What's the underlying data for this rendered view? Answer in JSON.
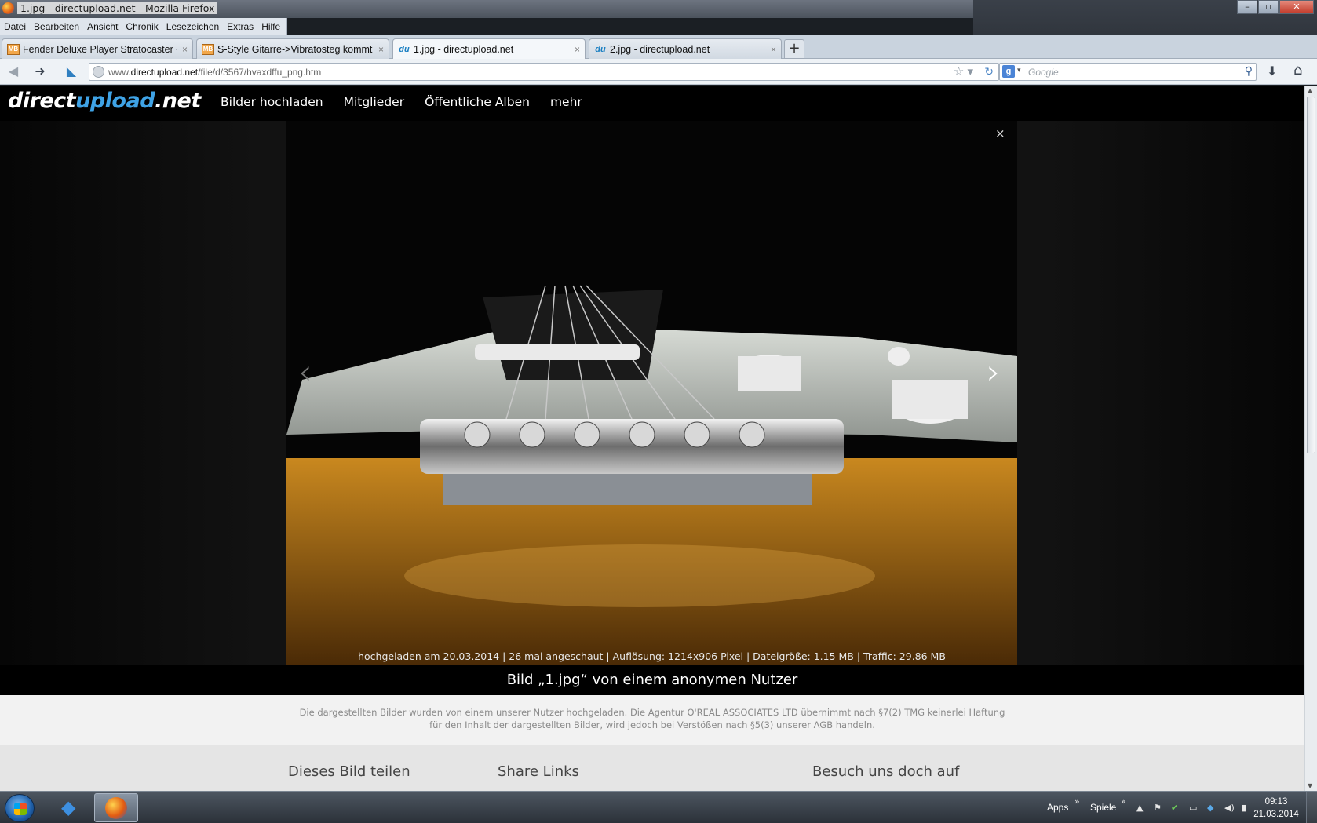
{
  "window": {
    "title": "1.jpg - directupload.net - Mozilla Firefox",
    "controls": {
      "minimize": "–",
      "maximize": "▫",
      "close": "✕"
    }
  },
  "menubar": [
    "Datei",
    "Bearbeiten",
    "Ansicht",
    "Chronik",
    "Lesezeichen",
    "Extras",
    "Hilfe"
  ],
  "tabs": [
    {
      "favicon": "MB",
      "label": "Fender Deluxe Player Stratocaster - ko...",
      "active": false
    },
    {
      "favicon": "MB",
      "label": "S-Style Gitarre->Vibratosteg kommt ...",
      "active": false
    },
    {
      "favicon": "du",
      "label": "1.jpg - directupload.net",
      "active": true
    },
    {
      "favicon": "du",
      "label": "2.jpg - directupload.net",
      "active": false
    }
  ],
  "tab_close": "×",
  "new_tab": "+",
  "navbar": {
    "url_prefix": "www.",
    "url_domain": "directupload.net",
    "url_path": "/file/d/3567/hvaxdffu_png.htm",
    "search_placeholder": "Google",
    "icons": [
      "back-icon",
      "forward-icon",
      "identity-icon",
      "bookmark-star-icon",
      "reload-icon",
      "search-engine-icon",
      "download-icon",
      "home-icon"
    ]
  },
  "site": {
    "logo_a": "direct",
    "logo_b": "upload",
    "logo_c": ".net",
    "nav": [
      "Bilder hochladen",
      "Mitglieder",
      "Öffentliche Alben",
      "mehr"
    ],
    "close_label": "×",
    "prev_label": "‹",
    "next_label": "›",
    "photo_meta": "hochgeladen am 20.03.2014 | 26 mal angeschaut | Auflösung: 1214x906 Pixel | Dateigröße: 1.15 MB | Traffic: 29.86 MB",
    "caption": "Bild „1.jpg“ von einem anonymen Nutzer",
    "disclaimer_line1": "Die dargestellten Bilder wurden von einem unserer Nutzer hochgeladen. Die Agentur O'REAL ASSOCIATES LTD übernimmt nach §7(2) TMG keinerlei Haftung",
    "disclaimer_line2": "für den Inhalt der dargestellten Bilder, wird jedoch bei Verstößen nach §5(3) unserer AGB handeln.",
    "share_headings": [
      "Dieses Bild teilen",
      "Share Links",
      "Besuch uns doch auf"
    ]
  },
  "taskbar": {
    "tray_apps": "Apps",
    "tray_games": "Spiele",
    "time": "09:13",
    "date": "21.03.2014"
  }
}
